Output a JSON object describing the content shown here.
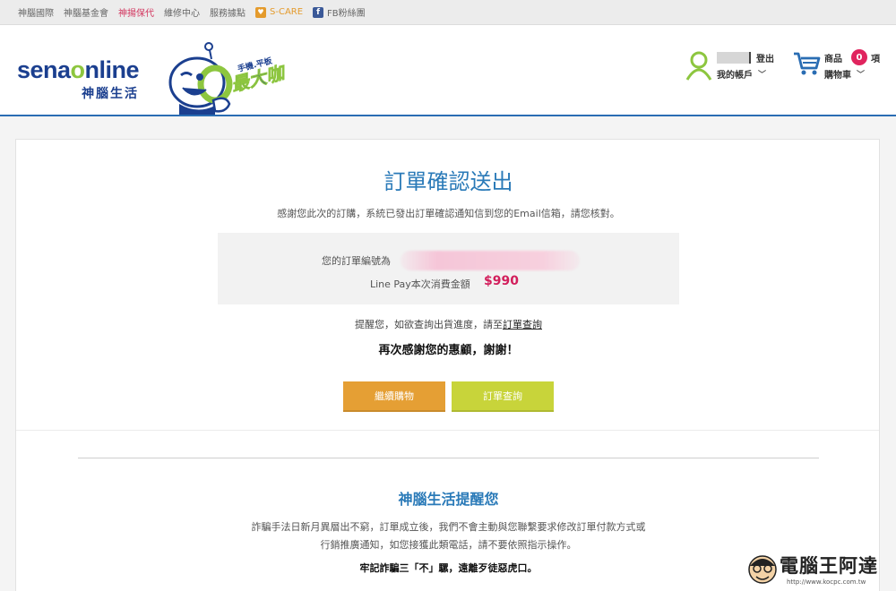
{
  "topbar": {
    "links": [
      "神腦國際",
      "神腦基金會",
      "神揚保代",
      "維修中心",
      "服務據點"
    ],
    "scare": "S-CARE",
    "fb": "FB粉絲團",
    "colors": {
      "highlight": "#d2355e",
      "scare": "#e49b2d",
      "facebook": "#3b5998"
    }
  },
  "header": {
    "logo_en_a": "sena",
    "logo_en_o": "o",
    "logo_en_b": "nline",
    "logo_zh": "神腦生活",
    "mascot_tag_small": "手機.平板",
    "mascot_tag_big": "最大咖",
    "account": {
      "logout": "登出",
      "my_account": "我的帳戶"
    },
    "cart": {
      "label": "商品",
      "count": "0",
      "unit": "項",
      "cart_label": "購物車"
    },
    "colors": {
      "brand_blue": "#1b3f8f",
      "brand_green": "#8dc63f",
      "header_line": "#2a6db3"
    }
  },
  "order": {
    "title": "訂單確認送出",
    "subtitle": "感謝您此次的訂購，系統已發出訂單確認通知信到您的Email信箱，請您核對。",
    "order_number_label": "您的訂單編號為",
    "payment_label": "Line Pay本次消費金額",
    "payment_amount": "$990",
    "remind_prefix": "提醒您，如欲查詢出貨進度，請至",
    "remind_link": "訂單查詢",
    "thanks": "再次感謝您的惠顧，謝謝！",
    "continue_button": "繼續購物",
    "query_button": "訂單查詢",
    "colors": {
      "title": "#2a7ab8",
      "amount": "#d21e5b",
      "continue": "#e59f34",
      "query": "#c8d43a"
    }
  },
  "notice": {
    "title": "神腦生活提醒您",
    "line1": "詐騙手法日新月異層出不窮，訂單成立後，我們不會主動與您聯繫要求修改訂單付款方式或",
    "line2": "行銷推廣通知，如您接獲此類電話，請不要依照指示操作。",
    "bold": "牢記詐騙三「不」騾，遠離歹徒惡虎口。"
  },
  "watermark": {
    "text": "電腦王阿達",
    "url": "http://www.kocpc.com.tw"
  }
}
